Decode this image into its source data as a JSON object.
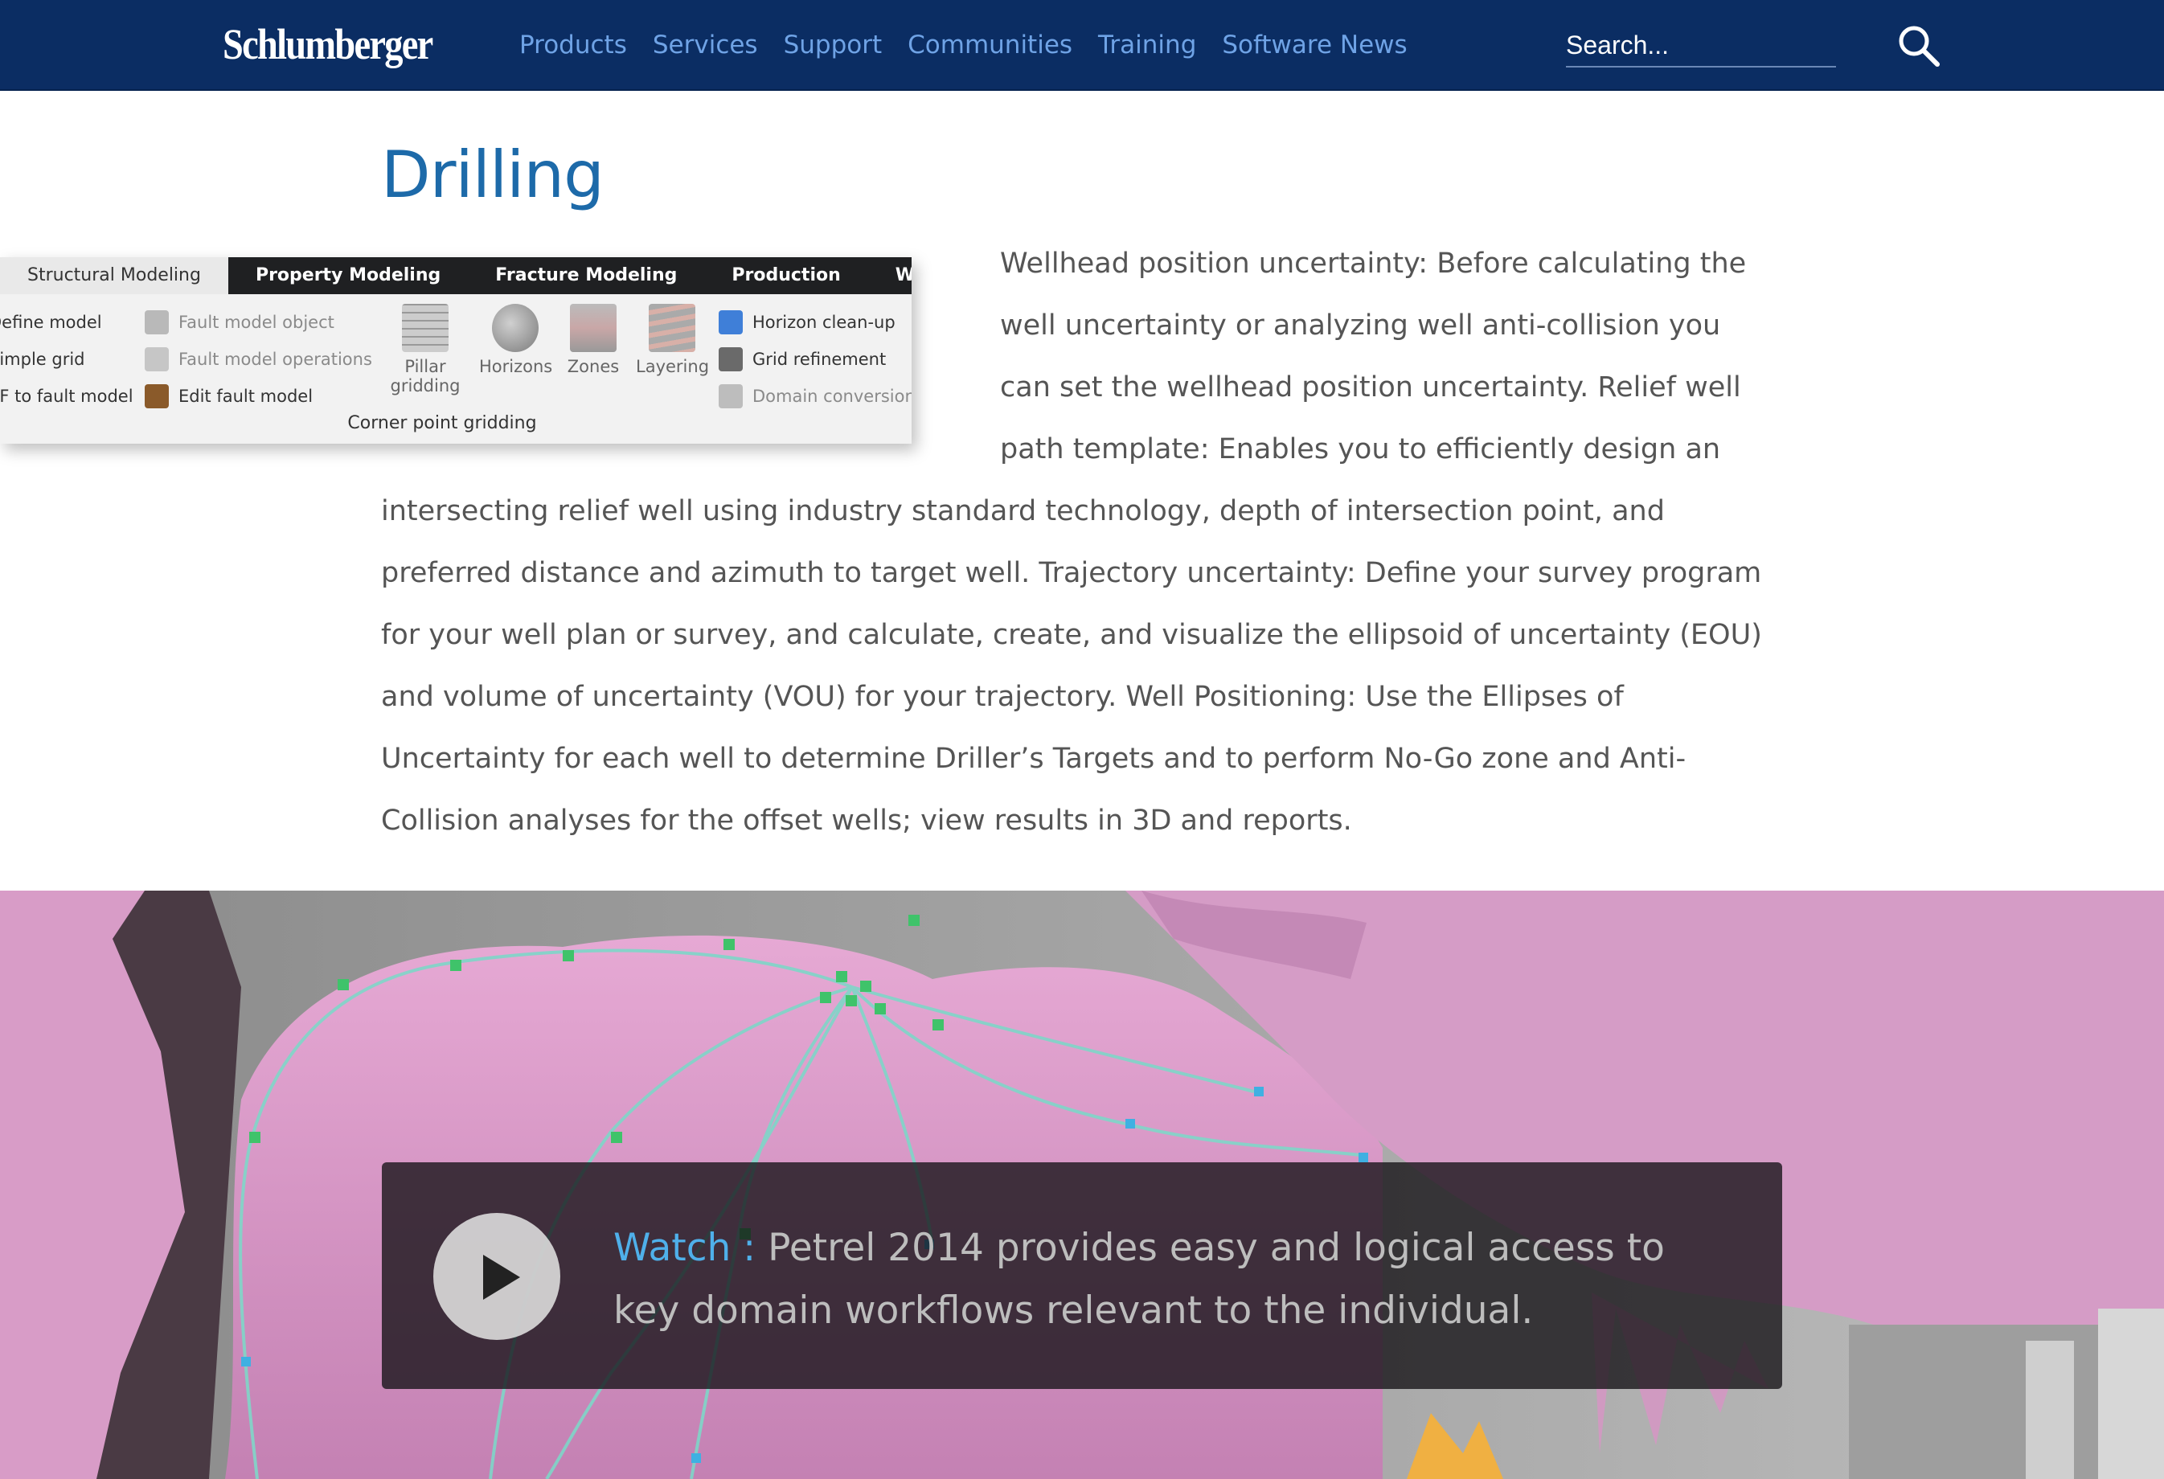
{
  "header": {
    "logo": "Schlumberger",
    "nav": [
      "Products",
      "Services",
      "Support",
      "Communities",
      "Training",
      "Software News"
    ],
    "search_placeholder": "Search..."
  },
  "main": {
    "title": "Drilling",
    "ribbon": {
      "tabs": [
        "Structural Modeling",
        "Property Modeling",
        "Fracture Modeling",
        "Production",
        "Well Design"
      ],
      "left_items": [
        "Define model",
        "Simple grid",
        "SF to fault model"
      ],
      "middle_items": [
        "Fault model object",
        "Fault model operations",
        "Edit fault model"
      ],
      "big_buttons": [
        "Pillar gridding",
        "Horizons",
        "Zones",
        "Layering"
      ],
      "right_items": [
        "Horizon clean-up",
        "Grid refinement",
        "Domain conversion"
      ],
      "group_label": "Corner point gridding"
    },
    "body_text": "Wellhead position uncertainty: Before calculating the well uncertainty or analyzing well anti-collision you can set the wellhead position uncertainty. Relief well path template: Enables you to efficiently design an intersecting relief well using industry standard technology, depth of intersection point, and preferred distance and azimuth to target well. Trajectory uncertainty: Define your survey program for your well plan or survey, and calculate, create, and visualize the ellipsoid of uncertainty (EOU) and volume of uncertainty (VOU) for your trajectory. Well Positioning: Use the Ellipses of Uncertainty for each well to determine Driller’s Targets and to perform No-Go zone and Anti-Collision analyses for the offset wells; view results in 3D and reports."
  },
  "hero": {
    "watch_label": "Watch :",
    "watch_text": "Petrel 2014 provides easy and logical access to key domain workflows relevant to the individual."
  },
  "colors": {
    "header_bg": "#0b2d63",
    "nav_link": "#6fa3e6",
    "title": "#1d6aa9",
    "body_text": "#555555",
    "watch_label": "#4fb0ea"
  }
}
